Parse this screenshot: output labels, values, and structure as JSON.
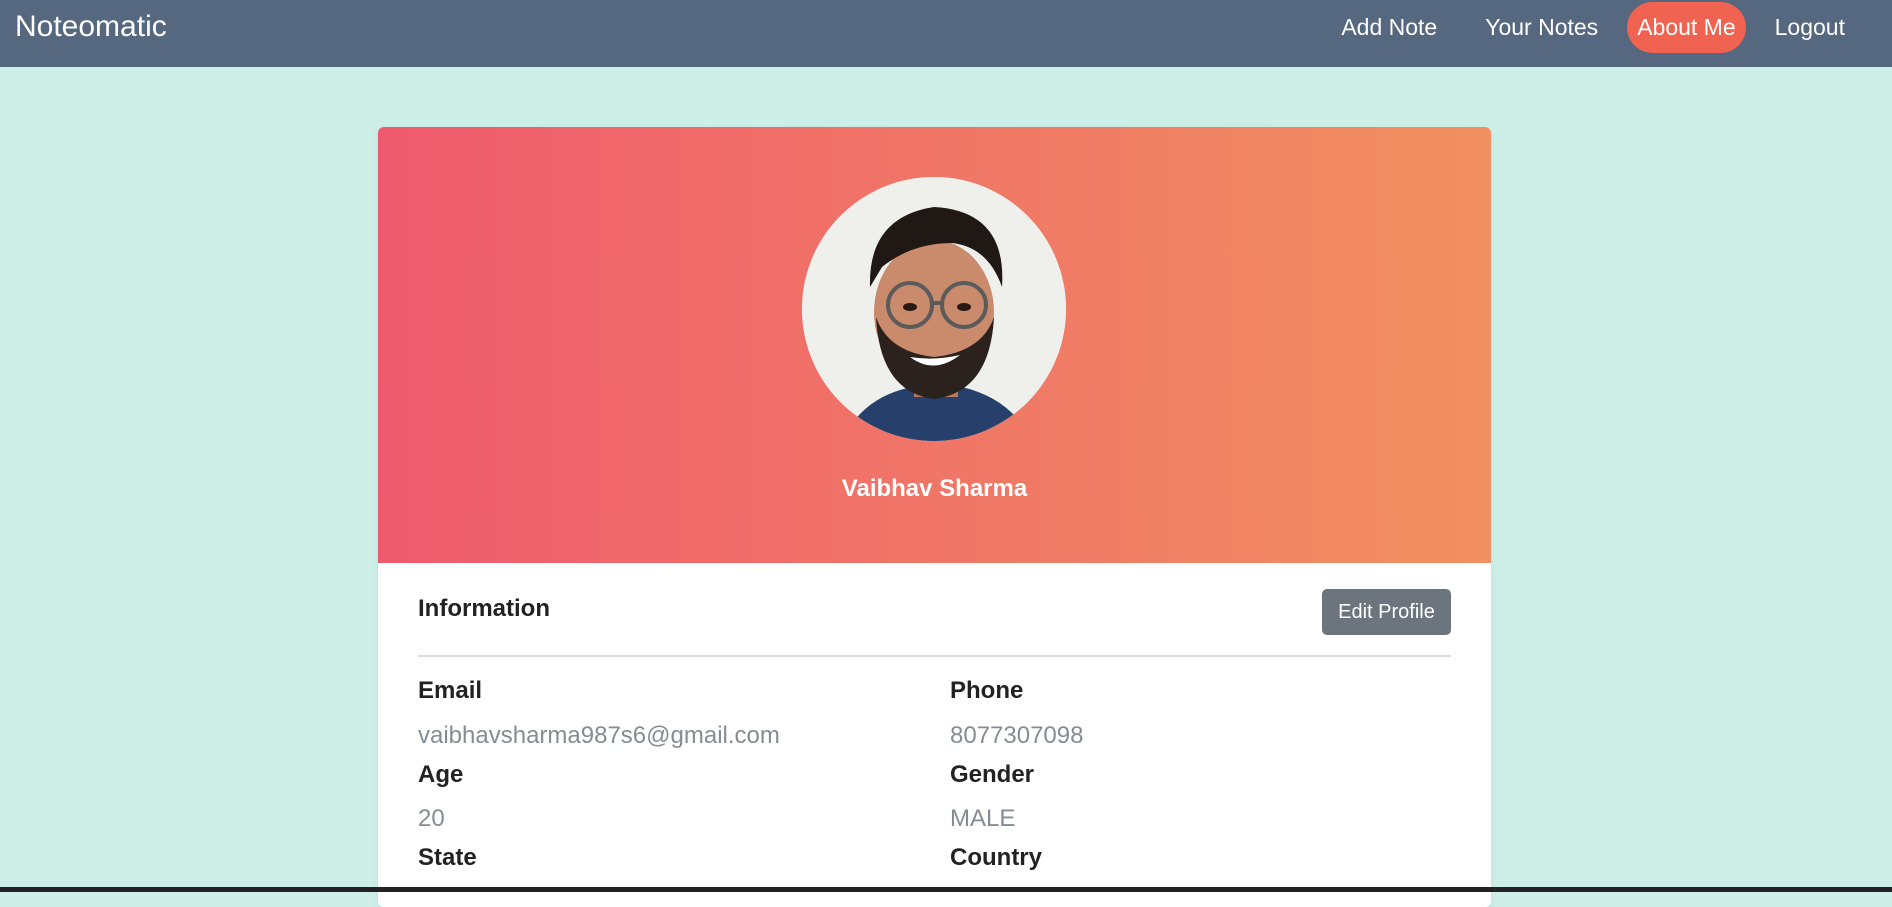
{
  "navbar": {
    "brand": "Noteomatic",
    "links": [
      {
        "label": "Add Note"
      },
      {
        "label": "Your Notes"
      },
      {
        "label": "About Me"
      },
      {
        "label": "Logout"
      }
    ],
    "active_link": "About Me"
  },
  "profile": {
    "name": "Vaibhav Sharma"
  },
  "info": {
    "title": "Information",
    "edit_label": "Edit Profile",
    "email_label": "Email",
    "email_value": "vaibhavsharma987s6@gmail.com",
    "phone_label": "Phone",
    "phone_value": "8077307098",
    "age_label": "Age",
    "age_value": "20",
    "gender_label": "Gender",
    "gender_value": "MALE",
    "state_label": "State",
    "country_label": "Country"
  },
  "colors": {
    "navbar": "#56687f",
    "active_link": "#f06351",
    "page_background": "#cdefe8",
    "header_gradient_start": "#ef5b6e",
    "header_gradient_end": "#f19060",
    "edit_button": "#6c757d"
  }
}
